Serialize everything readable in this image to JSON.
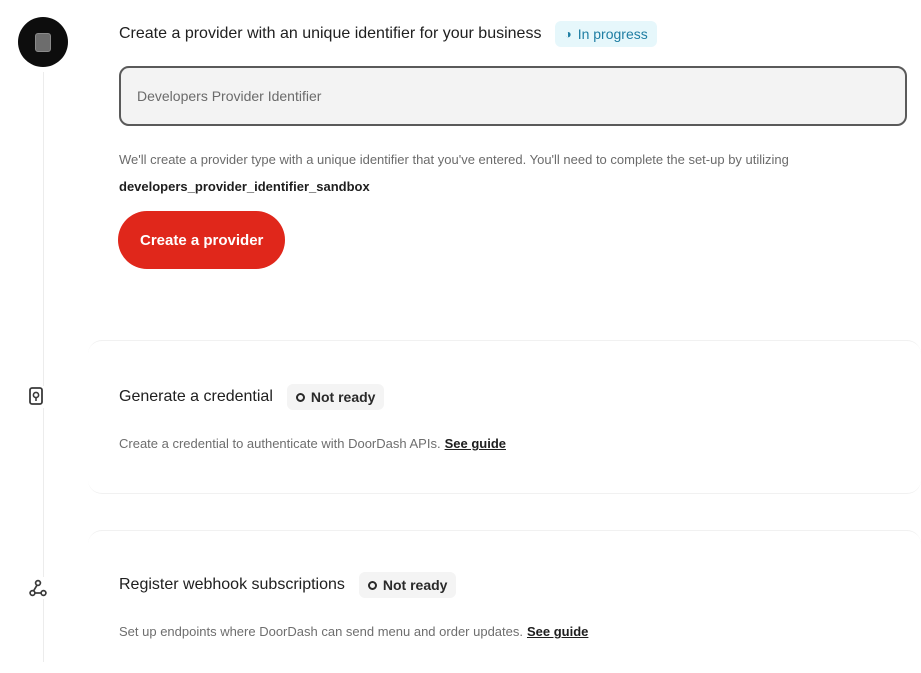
{
  "steps": [
    {
      "title": "Create a provider with an unique identifier for your business",
      "status": "In progress",
      "status_icon": "half-circle-icon",
      "input": {
        "placeholder": "Developers Provider Identifier",
        "value": ""
      },
      "help_text_prefix": "We'll create a provider type with a unique identifier that you've entered. You'll need to complete the set-up by utilizing",
      "help_code": "developers_provider_identifier_sandbox",
      "button_label": "Create a provider",
      "icon": "provider-icon"
    },
    {
      "title": "Generate a credential",
      "status": "Not ready",
      "status_icon": "ring-icon",
      "description": "Create a credential to authenticate with DoorDash APIs.",
      "link_label": "See guide",
      "icon": "key-icon"
    },
    {
      "title": "Register webhook subscriptions",
      "status": "Not ready",
      "status_icon": "ring-icon",
      "description": "Set up endpoints where DoorDash can send menu and order updates.",
      "link_label": "See guide",
      "icon": "webhook-icon"
    }
  ],
  "colors": {
    "primary_button": "#e0271b",
    "in_progress_bg": "#e6f7fb",
    "in_progress_text": "#1f7ea3",
    "not_ready_bg": "#f4f4f4"
  }
}
